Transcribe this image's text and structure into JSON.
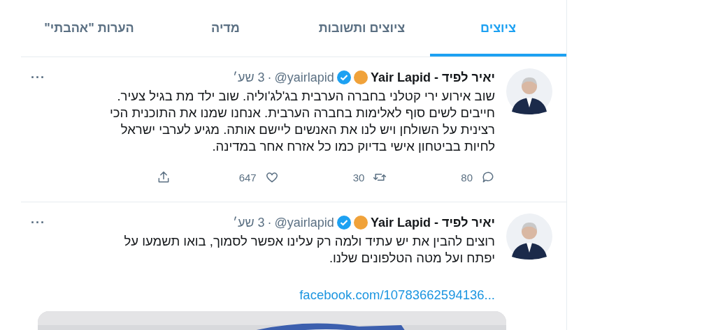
{
  "tabs": [
    {
      "label": "ציוצים",
      "selected": true
    },
    {
      "label": "ציוצים ותשובות",
      "selected": false
    },
    {
      "label": "מדיה",
      "selected": false
    },
    {
      "label": "הערות \"אהבתי\"",
      "selected": false
    }
  ],
  "tweets": [
    {
      "name": "יאיר לפיד - Yair Lapid",
      "verified": true,
      "handle": "@yairlapid",
      "separator": "·",
      "time": "3 שע׳",
      "more": "···",
      "text": "שוב אירוע ירי קטלני בחברה הערבית בג'לג'וליה. שוב ילד מת בגיל צעיר.\nחייבים לשים סוף לאלימות בחברה הערבית. אנחנו שמנו את התוכנית הכי\nרצינית על השולחן ויש לנו את האנשים ליישם אותה. מגיע לערבי ישראל\nלחיות בביטחון אישי בדיוק כמו כל אזרח אחר במדינה.",
      "replies": "80",
      "retweets": "30",
      "likes": "647"
    },
    {
      "name": "יאיר לפיד - Yair Lapid",
      "verified": true,
      "handle": "@yairlapid",
      "separator": "·",
      "time": "3 שע׳",
      "more": "···",
      "text": "רוצים להבין את יש עתיד ולמה רק עלינו אפשר לסמוך, בואו תשמעו על\nיפתח ועל מטה הטלפונים שלנו.",
      "link": "facebook.com/10783662594136..."
    }
  ]
}
